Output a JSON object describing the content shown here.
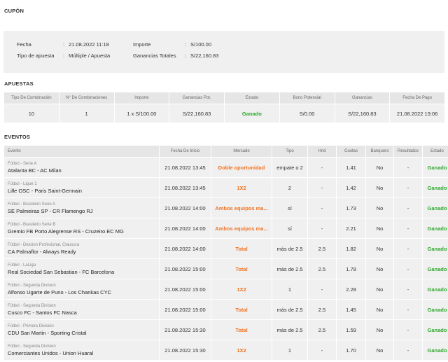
{
  "sections": {
    "coupon": "CUPÓN",
    "bets": "APUESTAS",
    "events": "EVENTOS"
  },
  "coupon": {
    "fecha_label": "Fecha",
    "fecha": "21.08.2022 11:18",
    "tipo_label": "Tipo de apuesta",
    "tipo": "Múltiple / Apuesta",
    "importe_label": "Importe",
    "importe": "S/100.00",
    "ganancias_label": "Ganancias Totales",
    "ganancias": "S/22,160.83",
    "colon": ":"
  },
  "bets": {
    "headers": [
      "Tipo De Combinación",
      "N° De Combinaciones",
      "Importe",
      "Ganancias Pot.",
      "Estado",
      "Bono Potencial",
      "Ganancias",
      "Fecha De Pago"
    ],
    "row": [
      "10",
      "1",
      "1 x S/100.00",
      "S/22,160.83",
      "Ganado",
      "S/0.00",
      "S/22,160.83",
      "21.08.2022 19:06"
    ]
  },
  "events": {
    "headers": [
      "Evento",
      "Fecha De Inicio",
      "Mercado",
      "Tipo",
      "Hnd",
      "Cuotas",
      "Banquero",
      "Resultados",
      "Estado"
    ],
    "rows": [
      {
        "league": "Fútbol - Serie A",
        "match": "Atalanta BC - AC Milan",
        "date": "21.08.2022 13:45",
        "market": "Doble oportunidad",
        "tipo": "empate o 2",
        "hnd": "-",
        "odds": "1.41",
        "banker": "No",
        "result": "-",
        "status": "Ganado"
      },
      {
        "league": "Fútbol - Ligue 1",
        "match": "Lille OSC - Paris Saint-Germain",
        "date": "21.08.2022 13:45",
        "market": "1X2",
        "tipo": "2",
        "hnd": "-",
        "odds": "1.42",
        "banker": "No",
        "result": "-",
        "status": "Ganado"
      },
      {
        "league": "Fútbol - Brasileiro Serie A",
        "match": "SE Palmeiras SP - CR Flamengo RJ",
        "date": "21.08.2022 14:00",
        "market": "Ambos equipos ma...",
        "tipo": "sí",
        "hnd": "-",
        "odds": "1.73",
        "banker": "No",
        "result": "-",
        "status": "Ganado"
      },
      {
        "league": "Fútbol - Brasileiro Serie B",
        "match": "Gremio FB Porto Alegrense RS - Cruzeiro EC MG",
        "date": "21.08.2022 14:00",
        "market": "Ambos equipos ma...",
        "tipo": "sí",
        "hnd": "-",
        "odds": "2.21",
        "banker": "No",
        "result": "-",
        "status": "Ganado"
      },
      {
        "league": "Fútbol - Division Profesional, Clausura",
        "match": "CA Palmaflor - Always Ready",
        "date": "21.08.2022 14:00",
        "market": "Total",
        "tipo": "más de 2.5",
        "hnd": "2.5",
        "odds": "1.82",
        "banker": "No",
        "result": "-",
        "status": "Ganado"
      },
      {
        "league": "Fútbol - LaLiga",
        "match": "Real Sociedad San Sebastian - FC Barcelona",
        "date": "21.08.2022 15:00",
        "market": "Total",
        "tipo": "más de 2.5",
        "hnd": "2.5",
        "odds": "1.78",
        "banker": "No",
        "result": "-",
        "status": "Ganado"
      },
      {
        "league": "Fútbol - Segunda Division",
        "match": "Alfonso Ugarte de Puno - Los Chankas CYC",
        "date": "21.08.2022 15:00",
        "market": "1X2",
        "tipo": "1",
        "hnd": "-",
        "odds": "2.28",
        "banker": "No",
        "result": "-",
        "status": "Ganado"
      },
      {
        "league": "Fútbol - Segunda Division",
        "match": "Cusco FC - Santos FC Nasca",
        "date": "21.08.2022 15:00",
        "market": "Total",
        "tipo": "más de 2.5",
        "hnd": "2.5",
        "odds": "1.45",
        "banker": "No",
        "result": "-",
        "status": "Ganado"
      },
      {
        "league": "Fútbol - Primera Division",
        "match": "CDU San Martin - Sporting Cristal",
        "date": "21.08.2022 15:30",
        "market": "Total",
        "tipo": "más de 2.5",
        "hnd": "2.5",
        "odds": "1.59",
        "banker": "No",
        "result": "-",
        "status": "Ganado"
      },
      {
        "league": "Fútbol - Segunda Division",
        "match": "Comerciantes Unidos - Union Huaral",
        "date": "21.08.2022 15:30",
        "market": "1X2",
        "tipo": "1",
        "hnd": "-",
        "odds": "1.70",
        "banker": "No",
        "result": "-",
        "status": "Ganado"
      }
    ]
  }
}
